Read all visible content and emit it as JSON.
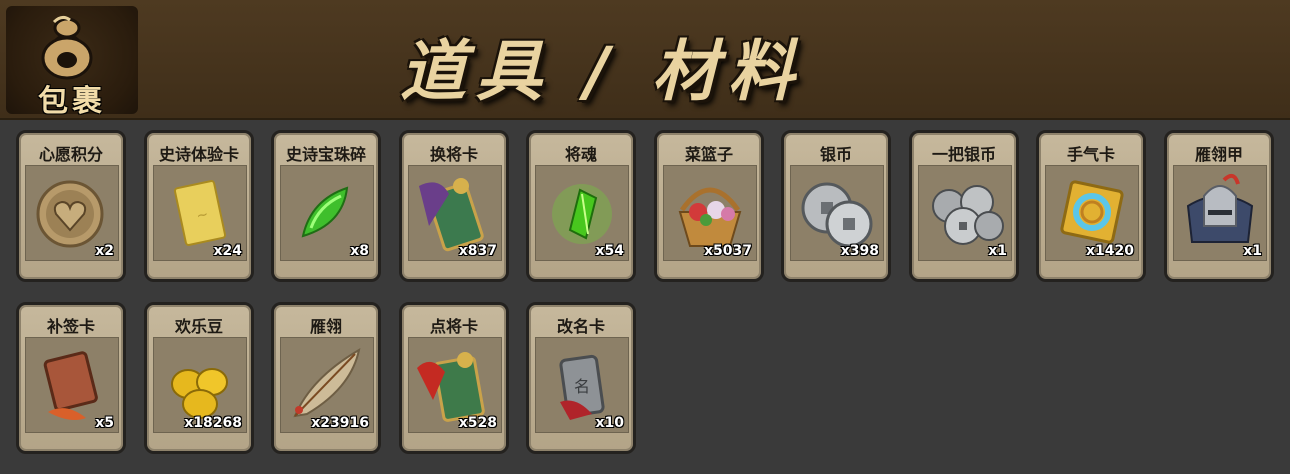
{
  "header": {
    "badge_text": "包裹",
    "title": "道具 / 材料"
  },
  "items": [
    {
      "name": "心愿积分",
      "count": "x2",
      "icon": "heart-coin-icon"
    },
    {
      "name": "史诗体验卡",
      "count": "x24",
      "icon": "gold-card-icon"
    },
    {
      "name": "史诗宝珠碎",
      "count": "x8",
      "icon": "green-gem-shard-icon"
    },
    {
      "name": "换将卡",
      "count": "x837",
      "icon": "general-swap-card-icon"
    },
    {
      "name": "将魂",
      "count": "x54",
      "icon": "green-soul-crystal-icon"
    },
    {
      "name": "菜篮子",
      "count": "x5037",
      "icon": "flower-basket-icon"
    },
    {
      "name": "银币",
      "count": "x398",
      "icon": "silver-coins-icon"
    },
    {
      "name": "一把银币",
      "count": "x1",
      "icon": "silver-coin-pile-icon"
    },
    {
      "name": "手气卡",
      "count": "x1420",
      "icon": "luck-card-icon"
    },
    {
      "name": "雁翎甲",
      "count": "x1",
      "icon": "armor-helmet-icon"
    },
    {
      "name": "补签卡",
      "count": "x5",
      "icon": "sign-in-card-icon"
    },
    {
      "name": "欢乐豆",
      "count": "x18268",
      "icon": "gold-beans-icon"
    },
    {
      "name": "雁翎",
      "count": "x23916",
      "icon": "feather-icon"
    },
    {
      "name": "点将卡",
      "count": "x528",
      "icon": "pick-general-card-icon"
    },
    {
      "name": "改名卡",
      "count": "x10",
      "icon": "rename-card-icon"
    }
  ]
}
